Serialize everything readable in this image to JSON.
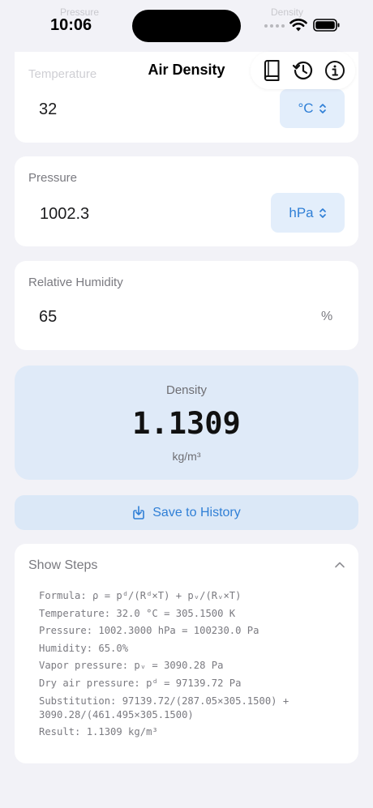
{
  "status_bar": {
    "time": "10:06",
    "faded_left": "Pressure",
    "faded_right": "Density"
  },
  "nav": {
    "title": "Air Density",
    "icons": [
      "book-icon",
      "history-icon",
      "info-icon"
    ]
  },
  "temperature": {
    "faded_label": "Temperature",
    "value": "32",
    "unit": "°C"
  },
  "pressure": {
    "label": "Pressure",
    "value": "1002.3",
    "unit": "hPa"
  },
  "humidity": {
    "label": "Relative Humidity",
    "value": "65",
    "unit": "%"
  },
  "result": {
    "label": "Density",
    "value": "1.1309",
    "unit": "kg/m³"
  },
  "save_button": {
    "label": "Save to History",
    "icon": "download-tray-icon"
  },
  "steps": {
    "title": "Show Steps",
    "lines": [
      "Formula: ρ = pᵈ/(Rᵈ×T) + pᵥ/(Rᵥ×T)",
      "Temperature: 32.0 °C = 305.1500 K",
      "Pressure: 1002.3000 hPa = 100230.0 Pa",
      "Humidity: 65.0%",
      "Vapor pressure: pᵥ = 3090.28 Pa",
      "Dry air pressure: pᵈ = 97139.72 Pa",
      "Substitution: 97139.72/(287.05×305.1500) + 3090.28/(461.495×305.1500)",
      "Result: 1.1309 kg/m³"
    ]
  },
  "colors": {
    "accent": "#2f7fd6",
    "background": "#f2f2f7",
    "result_card": "#dfeaf8"
  }
}
